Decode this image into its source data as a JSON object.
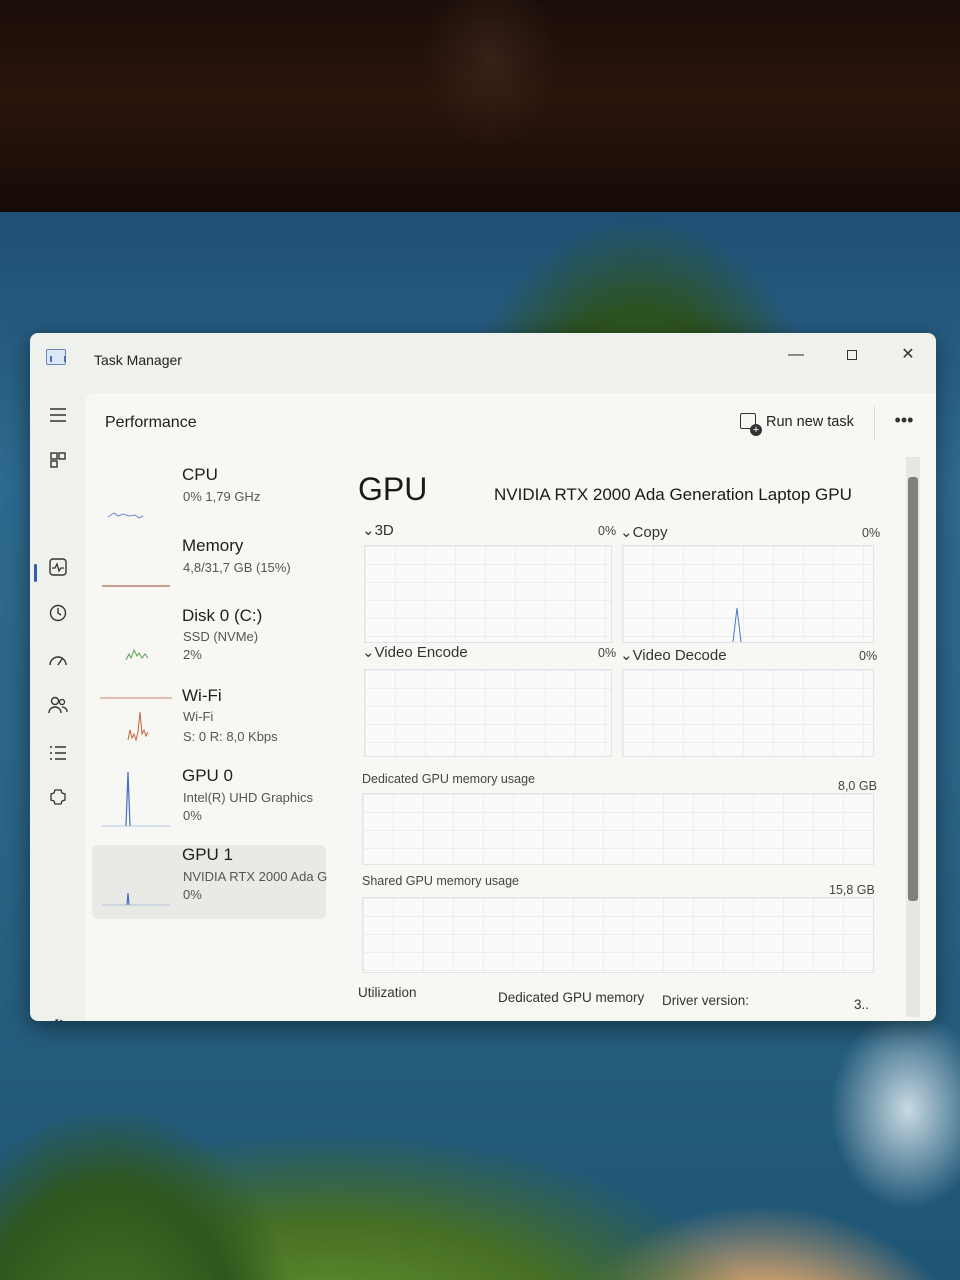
{
  "window": {
    "title": "Task Manager",
    "controls": {
      "minimize": "—",
      "close": "✕"
    }
  },
  "nav": [
    {
      "icon": "hamburger-icon"
    },
    {
      "icon": "processes-icon"
    },
    {
      "icon": "performance-icon",
      "active": true
    },
    {
      "icon": "app-history-icon"
    },
    {
      "icon": "startup-apps-icon"
    },
    {
      "icon": "users-icon"
    },
    {
      "icon": "details-icon"
    },
    {
      "icon": "services-icon"
    },
    {
      "icon": "settings-icon"
    }
  ],
  "header": {
    "title": "Performance",
    "run_new_task": "Run new task",
    "more": "•••"
  },
  "devices": [
    {
      "name": "CPU",
      "line1": "0%  1,79 GHz",
      "line2": "",
      "color": "#6f8fc9"
    },
    {
      "name": "Memory",
      "line1": "4,8/31,7 GB (15%)",
      "line2": "",
      "color": "#b06a4f"
    },
    {
      "name": "Disk 0 (C:)",
      "line1": "SSD (NVMe)",
      "line2": "2%",
      "color": "#5aa050"
    },
    {
      "name": "Wi-Fi",
      "line1": "Wi-Fi",
      "line2": "S: 0  R: 8,0 Kbps",
      "color": "#c0623f"
    },
    {
      "name": "GPU 0",
      "line1": "Intel(R) UHD Graphics",
      "line2": "0%",
      "color": "#3f6fc2"
    },
    {
      "name": "GPU 1",
      "line1": "NVIDIA RTX 2000 Ada G",
      "line2": "0%",
      "color": "#3f6fc2",
      "selected": true
    }
  ],
  "gpu": {
    "heading": "GPU",
    "model": "NVIDIA RTX 2000 Ada Generation Laptop GPU",
    "engines": [
      {
        "label": "3D",
        "pct": "0%"
      },
      {
        "label": "Copy",
        "pct": "0%"
      },
      {
        "label": "Video Encode",
        "pct": "0%"
      },
      {
        "label": "Video Decode",
        "pct": "0%"
      }
    ],
    "dedicated_label": "Dedicated GPU memory usage",
    "dedicated_max": "8,0 GB",
    "shared_label": "Shared GPU memory usage",
    "shared_max": "15,8 GB",
    "footer": {
      "utilization": "Utilization",
      "dedicated": "Dedicated GPU memory",
      "driver": "Driver version:",
      "driver_value": "3.."
    }
  }
}
